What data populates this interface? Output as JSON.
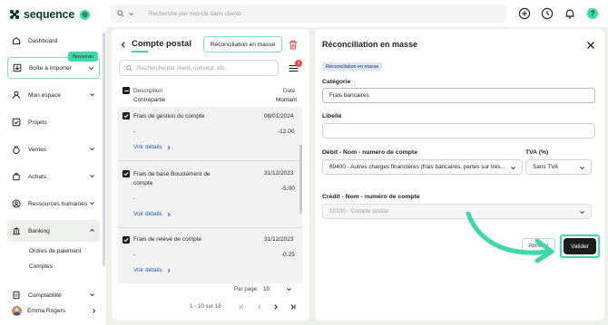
{
  "app": {
    "brand": "sequence",
    "brand_badge": "◎"
  },
  "topbar": {
    "search_placeholder": "Recherche par mot-clé dans clients"
  },
  "sidebar": {
    "items": [
      {
        "label": "Dashboard"
      },
      {
        "label": "Boîte à importer",
        "badge": "Nouveau"
      },
      {
        "label": "Mon espace"
      },
      {
        "label": "Projets"
      },
      {
        "label": "Ventes"
      },
      {
        "label": "Achats"
      },
      {
        "label": "Ressources humaines"
      },
      {
        "label": "Banking"
      },
      {
        "label": "Comptabilité"
      }
    ],
    "banking_sub": [
      "Ordres de paiement",
      "Comptes"
    ],
    "user": {
      "name": "Emma Rogers"
    }
  },
  "middle": {
    "title": "Compte postal",
    "reconcile_button": "Réconciliation en masse",
    "search_placeholder": "Recherche par client, concept, etc.",
    "filter_badge": "1",
    "columns": {
      "description": "Description",
      "counterpart": "Contrepartie",
      "date": "Date",
      "amount": "Montant"
    },
    "rows": [
      {
        "description": "Frais de gestion du compte",
        "date": "08/01/2024",
        "counterpart": "-",
        "amount": "-12.00",
        "link": "Voir détails"
      },
      {
        "description": "Frais de base Bouclement de compte",
        "date": "31/12/2023",
        "counterpart": "-",
        "amount": "-5.00",
        "link": "Voir détails"
      },
      {
        "description": "Frais de relevé de compte",
        "date": "31/12/2023",
        "counterpart": "-",
        "amount": "-0.25",
        "link": "Voir détails"
      }
    ],
    "pagination": {
      "per_page_label": "Par page:",
      "per_page_value": "10",
      "range": "1 - 10 sur 18"
    }
  },
  "right": {
    "title": "Réconciliation en masse",
    "tag": "Réconciliation en masse",
    "category_label": "Catégorie",
    "category_value": "Frais bancaires",
    "libelle_label": "Libellé",
    "libelle_value": "",
    "debit_label": "Débit - Nom - numéro de compte",
    "debit_value": "69400 - Autres charges financières (frais bancaires, pertes sur trés...",
    "tva_label": "TVA (%)",
    "tva_value": "Sans TVA",
    "credit_label": "Crédit - Nom - numéro de compte",
    "credit_value": "10100 - Compte postal",
    "cancel_label": "Annuler",
    "submit_label": "Valider"
  },
  "colors": {
    "accent": "#3ed9a7",
    "brand_dark": "#0b3d2c",
    "danger": "#e5484d",
    "dark_button": "#1c1c1c"
  }
}
